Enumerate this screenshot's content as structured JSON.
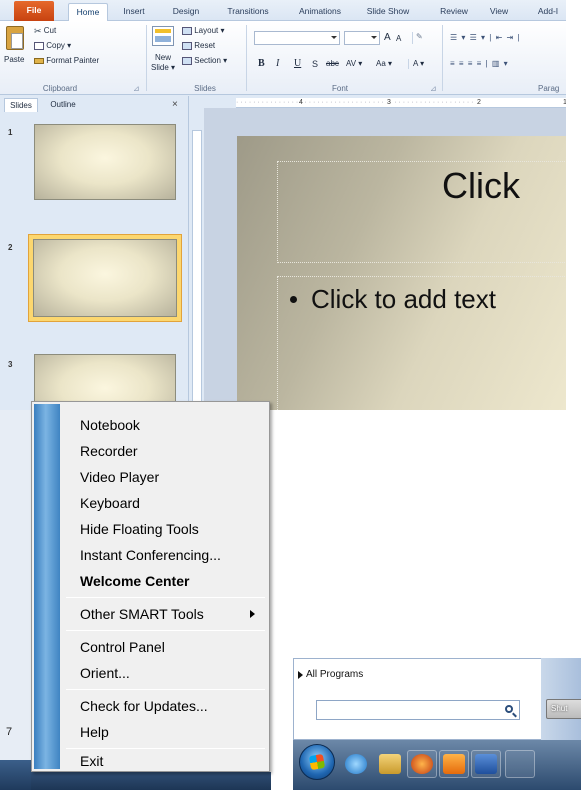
{
  "ribbon": {
    "tabs": [
      "File",
      "Home",
      "Insert",
      "Design",
      "Transitions",
      "Animations",
      "Slide Show",
      "Review",
      "View",
      "Add-I"
    ],
    "clipboard": {
      "paste": "Paste",
      "cut": "Cut",
      "copy": "Copy ▾",
      "format_painter": "Format Painter",
      "label": "Clipboard"
    },
    "slides": {
      "new_slide": "New",
      "new_slide_2": "Slide ▾",
      "layout": "Layout ▾",
      "reset": "Reset",
      "section": "Section ▾",
      "label": "Slides"
    },
    "font": {
      "label": "Font",
      "grow": "A",
      "shrink": "A",
      "bold": "B",
      "italic": "I",
      "underline": "U",
      "strike": "S",
      "abc": "abc",
      "spacing": "AV ▾",
      "case": "Aa ▾",
      "color": "A ▾"
    },
    "paragraph": {
      "label": "Parag"
    }
  },
  "pane": {
    "tabs": [
      "Slides",
      "Outline"
    ],
    "close": "×",
    "thumbs": [
      "1",
      "2",
      "3"
    ]
  },
  "ruler": {
    "ticks": [
      "4",
      "3",
      "2",
      "1"
    ]
  },
  "slide": {
    "title": "Click",
    "body": "Click to add text"
  },
  "menu": {
    "items": [
      "Notebook",
      "Recorder",
      "Video Player",
      "Keyboard",
      "Hide Floating Tools",
      "Instant Conferencing...",
      "Welcome Center",
      "Other SMART Tools",
      "Control Panel",
      "Orient...",
      "Check for Updates...",
      "Help",
      "Exit"
    ]
  },
  "behind": {
    "seven": "7"
  },
  "start_menu": {
    "all_programs": "All Programs",
    "shutdown": "Shut"
  },
  "colors": {
    "file_tab": "#d9531e",
    "menu_strip": "#5b9bd5",
    "selected_thumb": "#fcd76f"
  }
}
